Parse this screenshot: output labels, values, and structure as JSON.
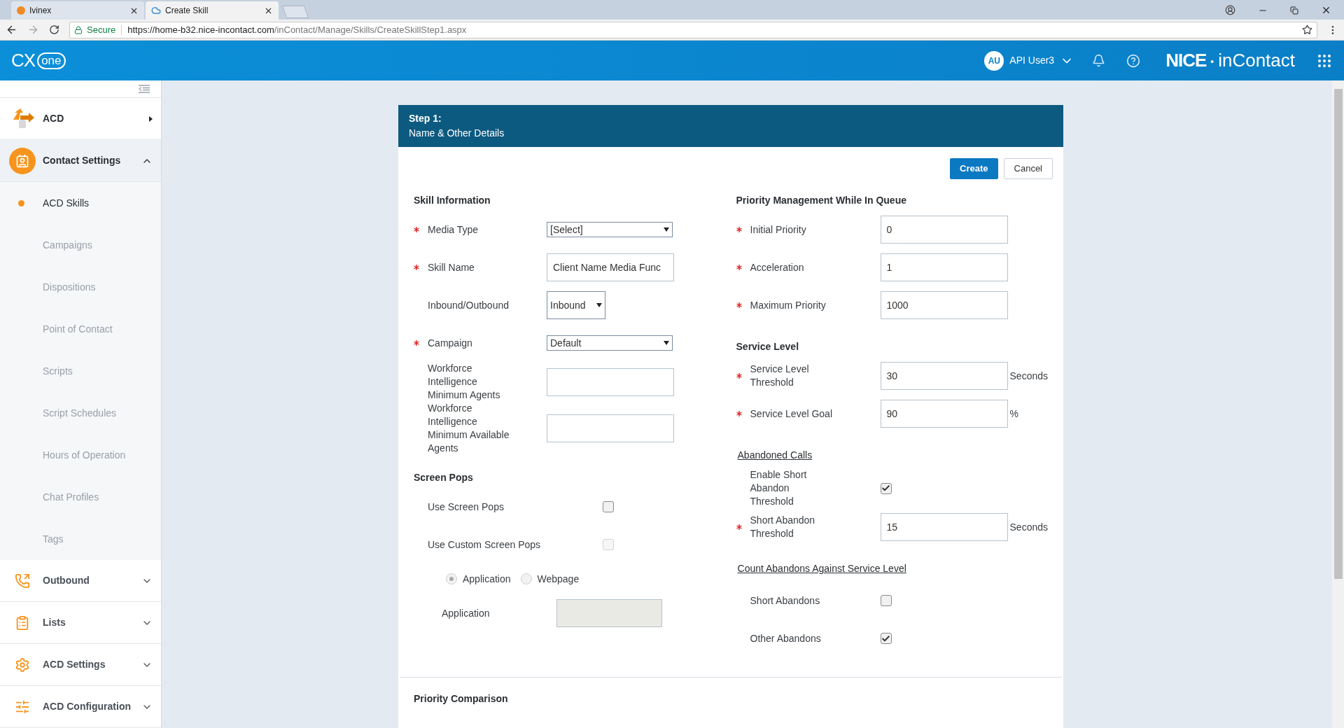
{
  "browser": {
    "tabs": [
      {
        "title": "Ivinex",
        "selected": false
      },
      {
        "title": "Create Skill",
        "selected": true
      }
    ],
    "secure_label": "Secure",
    "url_host": "https://home-b32.nice-incontact.com",
    "url_path": "/inContact/Manage/Skills/CreateSkillStep1.aspx"
  },
  "header": {
    "logo_main": "CX",
    "logo_sub": "one",
    "user_initials": "AU",
    "user_name": "API User3",
    "brand_main": "NICE",
    "brand_sep": "•",
    "brand_sub": "inContact"
  },
  "sidebar": [
    {
      "label": "ACD",
      "kind": "flyout",
      "expanded": false
    },
    {
      "label": "Contact Settings",
      "kind": "group",
      "expanded": true,
      "children": [
        {
          "label": "ACD Skills",
          "selected": true
        },
        {
          "label": "Campaigns",
          "selected": false
        },
        {
          "label": "Dispositions",
          "selected": false
        },
        {
          "label": "Point of Contact",
          "selected": false
        },
        {
          "label": "Scripts",
          "selected": false
        },
        {
          "label": "Script Schedules",
          "selected": false
        },
        {
          "label": "Hours of Operation",
          "selected": false
        },
        {
          "label": "Chat Profiles",
          "selected": false
        },
        {
          "label": "Tags",
          "selected": false
        }
      ]
    },
    {
      "label": "Outbound",
      "kind": "group",
      "expanded": false
    },
    {
      "label": "Lists",
      "kind": "group",
      "expanded": false
    },
    {
      "label": "ACD Settings",
      "kind": "group",
      "expanded": false
    },
    {
      "label": "ACD Configuration",
      "kind": "group",
      "expanded": false
    }
  ],
  "form": {
    "step": "Step 1:",
    "subtitle": "Name & Other Details",
    "buttons": [
      {
        "label": "Create",
        "kind": "primary"
      },
      {
        "label": "Cancel",
        "kind": "secondary"
      }
    ],
    "left": [
      {
        "title": "Skill Information",
        "kind": "heading",
        "rows": [
          {
            "kind": "select",
            "label": "Media Type",
            "required": true,
            "value": "[Select]"
          },
          {
            "kind": "text",
            "label": "Skill Name",
            "required": true,
            "value": "Client Name Media Func"
          },
          {
            "kind": "compact-select",
            "label": "Inbound/Outbound",
            "required": false,
            "value": "Inbound"
          },
          {
            "kind": "select",
            "label": "Campaign",
            "required": true,
            "value": "Default"
          },
          {
            "kind": "text",
            "label": "Workforce Intelligence Minimum Agents",
            "required": false,
            "value": ""
          },
          {
            "kind": "text",
            "label": "Workforce Intelligence Minimum Available Agents",
            "required": false,
            "value": ""
          }
        ]
      },
      {
        "title": "Screen Pops",
        "kind": "heading",
        "rows": [
          {
            "kind": "checkbox",
            "label": "Use Screen Pops",
            "checked": false,
            "disabled": false
          },
          {
            "kind": "checkbox",
            "label": "Use Custom Screen Pops",
            "checked": false,
            "disabled": true
          },
          {
            "kind": "radios",
            "disabled": true,
            "options": [
              {
                "label": "Application",
                "selected": true
              },
              {
                "label": "Webpage",
                "selected": false
              }
            ]
          },
          {
            "kind": "readonly",
            "label": "Application"
          }
        ]
      }
    ],
    "right": [
      {
        "title": "Priority Management While In Queue",
        "kind": "heading",
        "rows": [
          {
            "kind": "text",
            "label": "Initial Priority",
            "required": true,
            "value": "0"
          },
          {
            "kind": "text",
            "label": "Acceleration",
            "required": true,
            "value": "1"
          },
          {
            "kind": "text",
            "label": "Maximum Priority",
            "required": true,
            "value": "1000"
          }
        ]
      },
      {
        "title": "Service Level",
        "kind": "heading",
        "rows": [
          {
            "kind": "text",
            "label": "Service Level Threshold",
            "required": true,
            "value": "30",
            "unit": "Seconds"
          },
          {
            "kind": "text",
            "label": "Service Level Goal",
            "required": true,
            "value": "90",
            "unit": "%"
          }
        ]
      },
      {
        "title": "Abandoned Calls",
        "kind": "underlined",
        "rows": [
          {
            "kind": "checkbox",
            "label": "Enable Short Abandon Threshold",
            "checked": true,
            "disabled": false
          },
          {
            "kind": "text",
            "label": "Short Abandon Threshold",
            "required": true,
            "value": "15",
            "unit": "Seconds"
          }
        ]
      },
      {
        "title": "Count Abandons Against Service Level",
        "kind": "underlined",
        "rows": [
          {
            "kind": "checkbox",
            "label": "Short Abandons",
            "checked": false,
            "disabled": false
          },
          {
            "kind": "checkbox",
            "label": "Other Abandons",
            "checked": true,
            "disabled": false
          }
        ]
      }
    ],
    "footer_section": "Priority Comparison"
  }
}
